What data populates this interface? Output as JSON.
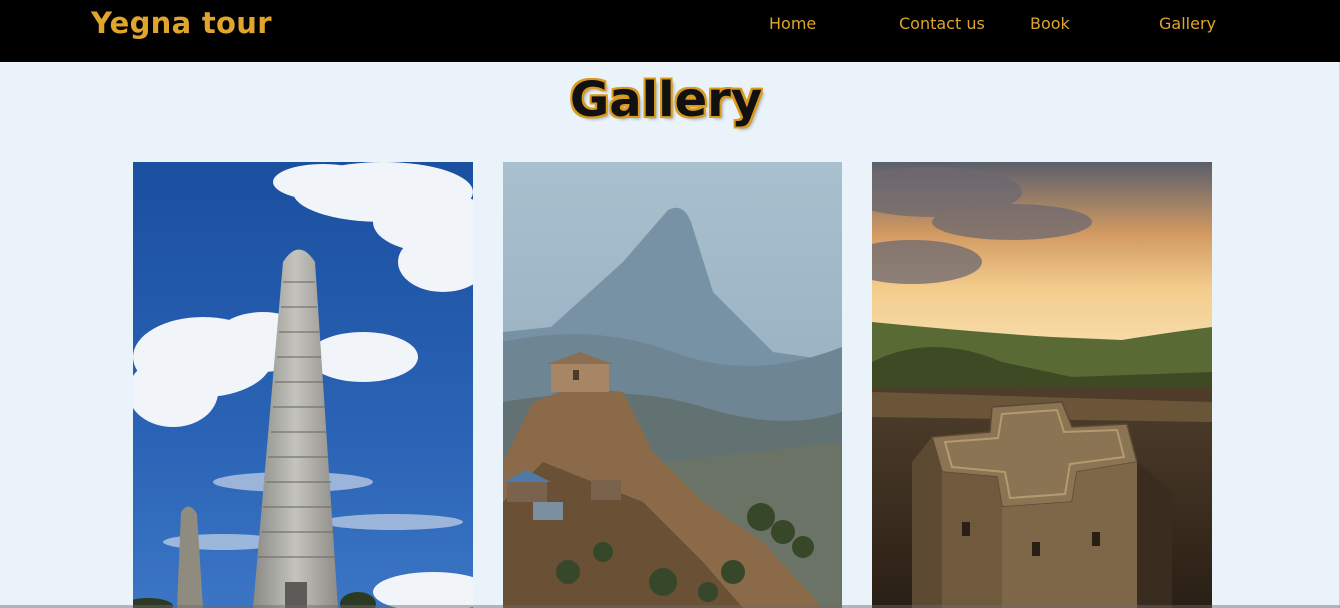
{
  "header": {
    "brand": "Yegna tour",
    "nav": [
      {
        "label": "Home"
      },
      {
        "label": "Contact us"
      },
      {
        "label": "Book"
      },
      {
        "label": "Gallery"
      }
    ]
  },
  "main": {
    "title": "Gallery",
    "photos": [
      {
        "subject": "Aksum obelisks against blue sky with clouds"
      },
      {
        "subject": "Hilltop monastery with steep rocky peak behind"
      },
      {
        "subject": "Rock-hewn cross-shaped church at sunset"
      }
    ]
  },
  "colors": {
    "navbar_bg": "#000000",
    "accent": "#e0a52a",
    "page_bg": "#eaf3fa"
  }
}
